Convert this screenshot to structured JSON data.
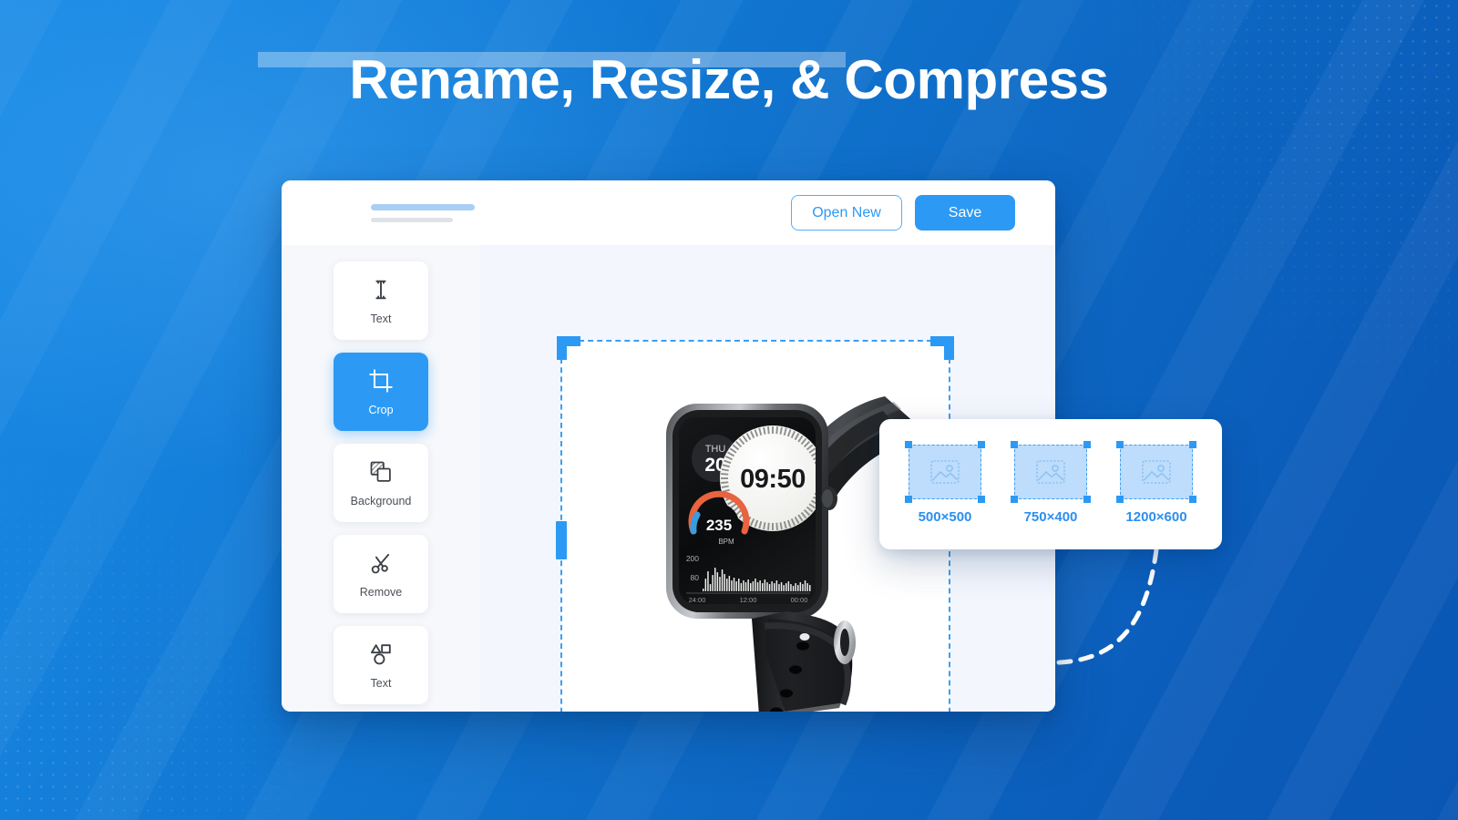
{
  "page": {
    "title": "Rename, Resize, & Compress",
    "background_color_start": "#1A8BE6",
    "background_color_end": "#0A56B4",
    "accent_color": "#2C9AF4"
  },
  "app": {
    "header": {
      "skeleton_placeholder": true,
      "open_new_label": "Open New",
      "save_label": "Save"
    },
    "sidebar": {
      "items": [
        {
          "label": "Text",
          "icon": "text-cursor-icon",
          "active": false
        },
        {
          "label": "Crop",
          "icon": "crop-icon",
          "active": true
        },
        {
          "label": "Background",
          "icon": "layers-icon",
          "active": false
        },
        {
          "label": "Remove",
          "icon": "scissors-icon",
          "active": false
        },
        {
          "label": "Text",
          "icon": "shapes-icon",
          "active": false
        }
      ]
    },
    "canvas": {
      "selection_tool": "crop",
      "image_alt": "black smartwatch with silicone band",
      "watch": {
        "day_label": "THU",
        "day_number": "20",
        "time": "09:50",
        "heart_rate_value": "235",
        "heart_rate_unit": "BPM",
        "chart_y_top": "200",
        "chart_y_bottom": "80",
        "chart_x_left": "24:00",
        "chart_x_mid": "12:00",
        "chart_x_right": "00:00"
      }
    }
  },
  "presets": {
    "items": [
      {
        "label": "500×500",
        "icon": "image-placeholder-icon"
      },
      {
        "label": "750×400",
        "icon": "image-placeholder-icon"
      },
      {
        "label": "1200×600",
        "icon": "image-placeholder-icon"
      }
    ]
  }
}
